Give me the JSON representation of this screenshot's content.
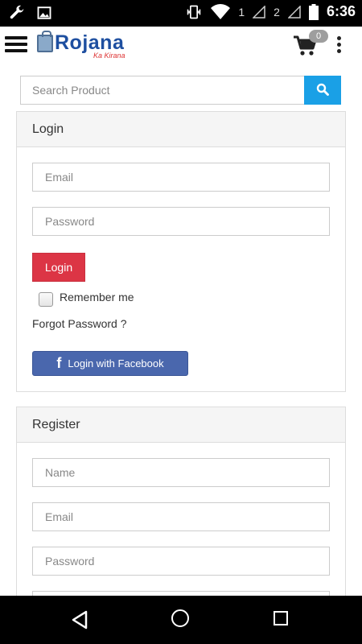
{
  "status_bar": {
    "time": "6:36",
    "sim1": "1",
    "sim2": "2",
    "icons": [
      "wrench-icon",
      "image-icon",
      "vibrate-icon",
      "wifi-icon",
      "signal-icon",
      "battery-icon"
    ]
  },
  "header": {
    "logo_text": "Rojana",
    "logo_sub": "Ka Kirana",
    "cart_count": "0",
    "icons": [
      "menu-icon",
      "cart-icon",
      "more-icon"
    ]
  },
  "search": {
    "placeholder": "Search Product",
    "button_icon": "search-icon",
    "button_color": "#1aa0e6"
  },
  "login": {
    "title": "Login",
    "email_placeholder": "Email",
    "password_placeholder": "Password",
    "login_label": "Login",
    "remember_label": "Remember me",
    "forgot_label": "Forgot Password ?",
    "facebook_label": "Login with Facebook",
    "login_color": "#dc3545",
    "facebook_color": "#4a67ad"
  },
  "register": {
    "title": "Register",
    "name_placeholder": "Name",
    "email_placeholder": "Email",
    "password_placeholder": "Password"
  },
  "nav_bar": {
    "icons": [
      "back-icon",
      "home-icon",
      "recents-icon"
    ]
  }
}
